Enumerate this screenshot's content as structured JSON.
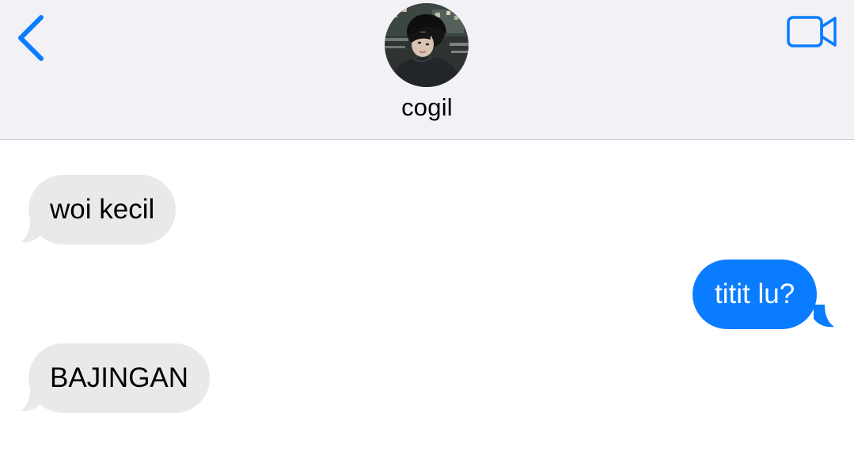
{
  "header": {
    "contact_name": "cogil",
    "back_icon": "chevron-left-icon",
    "video_icon": "video-camera-icon"
  },
  "messages": [
    {
      "direction": "incoming",
      "text": "woi kecil"
    },
    {
      "direction": "outgoing",
      "text": "titit lu?"
    },
    {
      "direction": "incoming",
      "text": "BAJINGAN"
    }
  ],
  "colors": {
    "accent": "#0a7cff",
    "incoming_bubble": "#e9e9eb",
    "header_bg": "#f1f1f6"
  }
}
